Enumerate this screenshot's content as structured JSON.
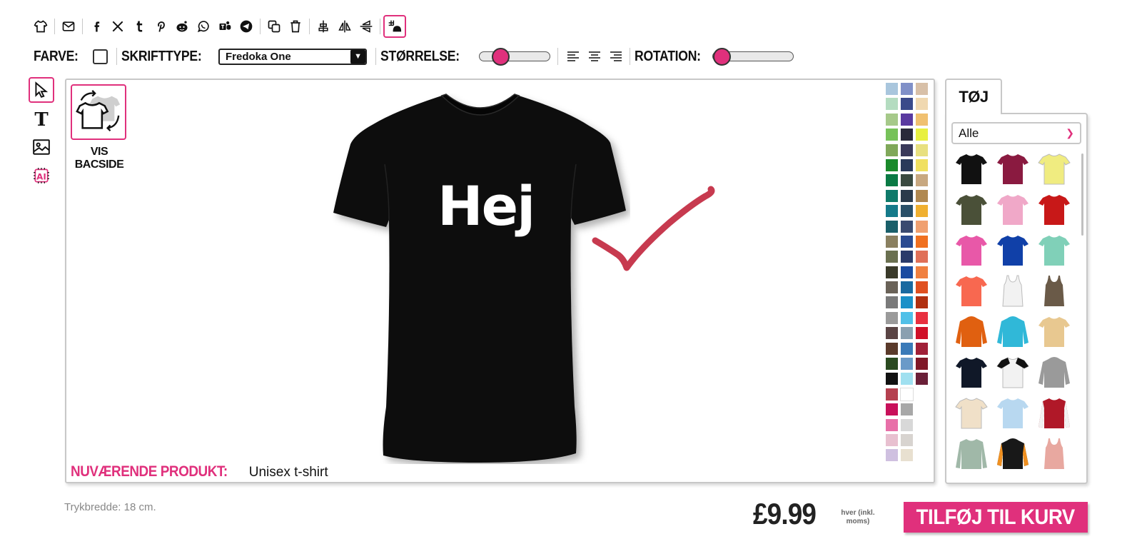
{
  "toolbar": {
    "icons": [
      "tshirt-icon",
      "email-icon",
      "facebook-icon",
      "x-icon",
      "tumblr-icon",
      "pinterest-icon",
      "reddit-icon",
      "whatsapp-icon",
      "teams-icon",
      "telegram-icon",
      "duplicate-icon",
      "trash-icon",
      "center-icon",
      "flip-horizontal-icon",
      "flip-vertical-icon",
      "grid-icon"
    ]
  },
  "format_bar": {
    "color_label": "FARVE:",
    "font_label": "SKRIFTTYPE:",
    "font_value": "Fredoka One",
    "size_label": "STØRRELSE:",
    "size_level": 0.25,
    "rotation_label": "ROTATION:",
    "rotation_level": 0.02
  },
  "tools": [
    "pointer-icon",
    "text-icon",
    "image-icon",
    "ai-icon"
  ],
  "canvas": {
    "flip_label": "VIS BACSIDE",
    "design_text": "Hej",
    "product_label": "NUVÆRENDE PRODUKT:",
    "product_name": "Unisex t-shirt"
  },
  "palette": {
    "colors": [
      "#a9c6dd",
      "#b4dcc0",
      "#a6c98a",
      "#77c25a",
      "#80a85a",
      "#1a8a2b",
      "#0a7a44",
      "#0f7a6a",
      "#157a8a",
      "#1a5f6a",
      "#8a8060",
      "#6a7050",
      "#3a3a2a",
      "#6a6258",
      "#7a7a7a",
      "#9a9a9a",
      "#5a4444",
      "#5a3a2a",
      "#2a4a20",
      "#111111",
      "#b5404f",
      "#c8105a",
      "#e870a8",
      "#e8c0d0",
      "#cfc0e0",
      "#8090c8",
      "#3a4a8a",
      "#5a3aa0",
      "#2a2a3a",
      "#3a3a5a",
      "#2a3a5a",
      "#3a4a40",
      "#2a3a4a",
      "#2a5068",
      "#3a4a70",
      "#2a4a90",
      "#2a3a6a",
      "#1a4aa0",
      "#1a6aa0",
      "#1a90c8",
      "#50c0e8",
      "#8aa0b0",
      "#3a7ab8",
      "#6a9ac8",
      "#a0e0f0",
      "#ffffff",
      "#a8a8a8",
      "#d8d8d8",
      "#d8d4d0",
      "#e8e0d0",
      "#d8c0a8",
      "#f0d8b0",
      "#f0c070",
      "#e8f040",
      "#e8e080",
      "#f0e060",
      "#c8a880",
      "#b08850",
      "#f0b030",
      "#f0a070",
      "#f07020",
      "#e07058",
      "#f08040",
      "#e05020",
      "#b03010",
      "#e83040",
      "#d01028",
      "#a02038",
      "#801828",
      "#6a2038"
    ]
  },
  "side_panel": {
    "tab_label": "TØJ",
    "category": "Alle",
    "garments": [
      {
        "name": "black-tshirt",
        "color": "#111111"
      },
      {
        "name": "maroon-tshirt",
        "color": "#8a1a40"
      },
      {
        "name": "yellow-tshirt",
        "color": "#f0ec80"
      },
      {
        "name": "olive-tshirt",
        "color": "#4a5038"
      },
      {
        "name": "pink-tshirt",
        "color": "#f0a8c8"
      },
      {
        "name": "red-tshirt",
        "color": "#c81818"
      },
      {
        "name": "fuchsia-tshirt",
        "color": "#e858a8"
      },
      {
        "name": "royal-blue-tshirt",
        "color": "#1040a8"
      },
      {
        "name": "mint-tshirt",
        "color": "#80d0b8"
      },
      {
        "name": "coral-tshirt",
        "color": "#f86850"
      },
      {
        "name": "white-tanktop",
        "color": "#f2f2f2"
      },
      {
        "name": "brown-tanktop",
        "color": "#6a5a48"
      },
      {
        "name": "orange-hoodie",
        "color": "#e06010"
      },
      {
        "name": "turquoise-hoodie",
        "color": "#30b8d8"
      },
      {
        "name": "tiedye-tshirt",
        "color": "#e8c890"
      },
      {
        "name": "navy-tshirt",
        "color": "#101828"
      },
      {
        "name": "raglan-tshirt",
        "color": "#f2f2f2"
      },
      {
        "name": "grey-hoodie",
        "color": "#9a9a9a"
      },
      {
        "name": "cream-tshirt",
        "color": "#f0e0c8"
      },
      {
        "name": "lightblue-fade-tshirt",
        "color": "#b8d8f0"
      },
      {
        "name": "red-college-jacket",
        "color": "#b01828"
      },
      {
        "name": "sage-longsleeve",
        "color": "#a0b8a8"
      },
      {
        "name": "black-orange-hoodie",
        "color": "#181818"
      },
      {
        "name": "blush-tanktop",
        "color": "#e8a8a0"
      }
    ]
  },
  "footer": {
    "print_width": "Trykbredde: 18 cm.",
    "price": "£9.99",
    "price_note": "hver (inkl. moms)",
    "add_to_cart": "TILFØJ TIL KURV"
  },
  "colors": {
    "accent": "#e0307c"
  }
}
